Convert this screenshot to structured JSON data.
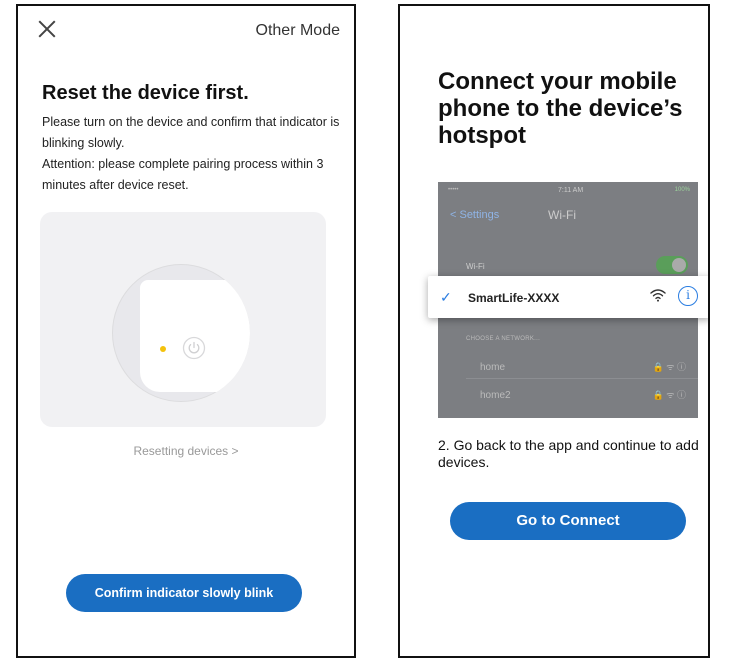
{
  "left_screen": {
    "close_icon": "close-icon",
    "other_mode": "Other Mode",
    "title": "Reset the device first.",
    "description_lines": [
      "Please turn on the device and confirm that indicator is blinking slowly.",
      "Attention: please complete pairing process within 3 minutes after device reset."
    ],
    "illustration": {
      "led_color": "#f4c20d",
      "icon": "power-icon"
    },
    "resetting_link": "Resetting devices >",
    "confirm_button": "Confirm indicator slowly blink"
  },
  "right_screen": {
    "title": "Connect your mobile phone to the device’s hotspot",
    "phone_screenshot": {
      "status_carrier": "•••••",
      "status_time": "7:11 AM",
      "status_battery": "100%",
      "back_label": "< Settings",
      "nav_title": "Wi-Fi",
      "wifi_label": "Wi-Fi",
      "choose_label": "CHOOSE A NETWORK...",
      "networks": [
        "home",
        "home2"
      ],
      "network_icons": "🔒 ᯤ ⓘ"
    },
    "selected_network": {
      "check_icon": "check-icon",
      "name": "SmartLife-XXXX",
      "wifi_icon": "wifi-icon",
      "info_icon": "info-icon"
    },
    "step_text": "2. Go back to the app and continue to add devices.",
    "connect_button": "Go to Connect"
  },
  "colors": {
    "accent": "#1a6ec2",
    "check": "#2a7de1",
    "led": "#f4c20d"
  }
}
